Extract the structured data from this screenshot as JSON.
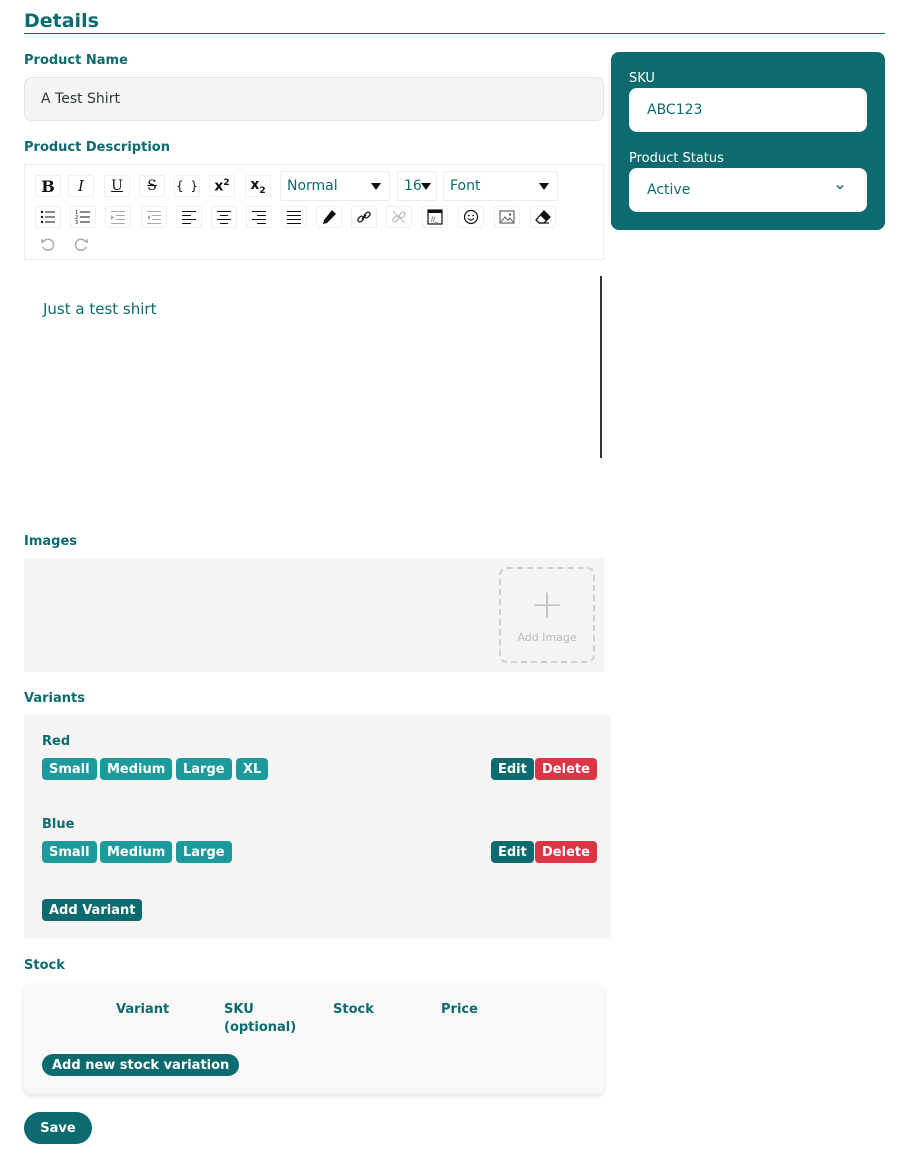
{
  "page": {
    "title": "Details"
  },
  "product_name": {
    "label": "Product Name",
    "value": "A Test Shirt"
  },
  "description": {
    "label": "Product Description",
    "block_style": "Normal",
    "font_size": "16",
    "font_family": "Font",
    "content": "Just a test shirt",
    "icons": [
      "bold-icon",
      "italic-icon",
      "underline-icon",
      "strikethrough-icon",
      "code-icon",
      "superscript-icon",
      "subscript-icon",
      "unordered-list-icon",
      "ordered-list-icon",
      "indent-icon",
      "outdent-icon",
      "align-left-icon",
      "align-center-icon",
      "align-right-icon",
      "align-justify-icon",
      "color-picker-icon",
      "link-icon",
      "unlink-icon",
      "embed-icon",
      "emoji-icon",
      "image-icon",
      "eraser-icon",
      "undo-icon",
      "redo-icon"
    ]
  },
  "images": {
    "label": "Images",
    "add_label": "Add Image"
  },
  "variants": {
    "label": "Variants",
    "items": [
      {
        "name": "Red",
        "sizes": [
          "Small",
          "Medium",
          "Large",
          "XL"
        ]
      },
      {
        "name": "Blue",
        "sizes": [
          "Small",
          "Medium",
          "Large"
        ]
      }
    ],
    "edit_label": "Edit",
    "delete_label": "Delete",
    "add_label": "Add Variant"
  },
  "stock": {
    "label": "Stock",
    "columns": [
      "Variant",
      "SKU\n(optional)",
      "Stock",
      "Price"
    ],
    "add_label": "Add new stock variation"
  },
  "save_label": "Save",
  "side": {
    "sku_label": "SKU",
    "sku_value": "ABC123",
    "status_label": "Product Status",
    "status_value": "Active"
  },
  "colors": {
    "primary": "#0b6b6e",
    "chip": "#1d9a9b",
    "danger": "#dc3545",
    "panel_bg": "#f5f5f5"
  }
}
